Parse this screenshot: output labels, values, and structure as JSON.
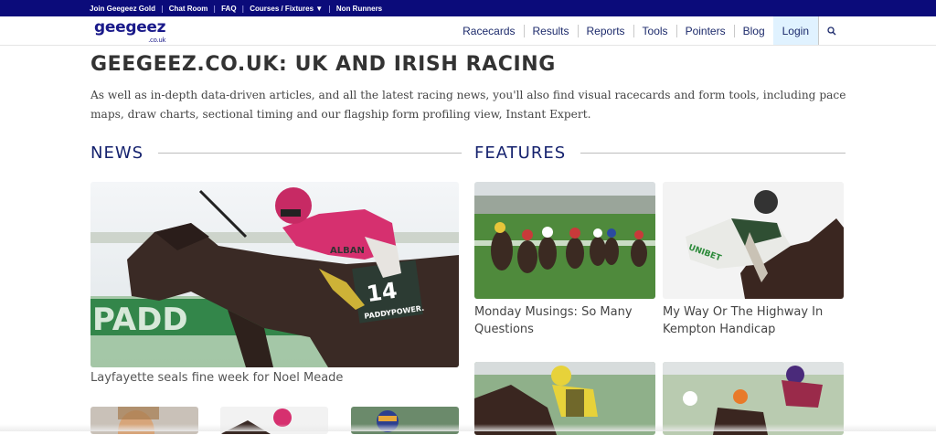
{
  "topbar": {
    "links": [
      "Join Geegeez Gold",
      "Chat Room",
      "FAQ",
      "Courses / Fixtures ▼",
      "Non Runners"
    ]
  },
  "header": {
    "logo_main": "geegeez",
    "logo_sub": ".co.uk",
    "nav": [
      "Racecards",
      "Results",
      "Reports",
      "Tools",
      "Pointers",
      "Blog"
    ],
    "login": "Login",
    "search_icon": "search-icon"
  },
  "main": {
    "title": "GEEGEEZ.CO.UK: UK AND IRISH RACING",
    "intro": "As well as in-depth data-driven articles, and all the latest racing news, you'll also find visual racecards and form tools, including pace maps, draw charts, sectional timing and our flagship form profiling view, Instant Expert."
  },
  "news": {
    "heading": "NEWS",
    "lead_caption": "Layfayette seals fine week for Noel Meade",
    "lead_cloth_number": "14",
    "lead_cloth_sponsor": "PADDYPOWER.",
    "lead_silks_text": "ALBAN",
    "rail_text": "PADD"
  },
  "features": {
    "heading": "FEATURES",
    "items": [
      {
        "caption_line1": "Monday Musings: So Many",
        "caption_line2": "Questions"
      },
      {
        "caption_line1": "My Way Or The Highway In",
        "caption_line2": "Kempton Handicap",
        "silks_text": "UNIBET"
      }
    ]
  },
  "colors": {
    "topbar_bg": "#0b0b7a",
    "heading_blue": "#15226e",
    "login_bg": "#e0f2ff",
    "jockey_pink": "#d6306f"
  }
}
